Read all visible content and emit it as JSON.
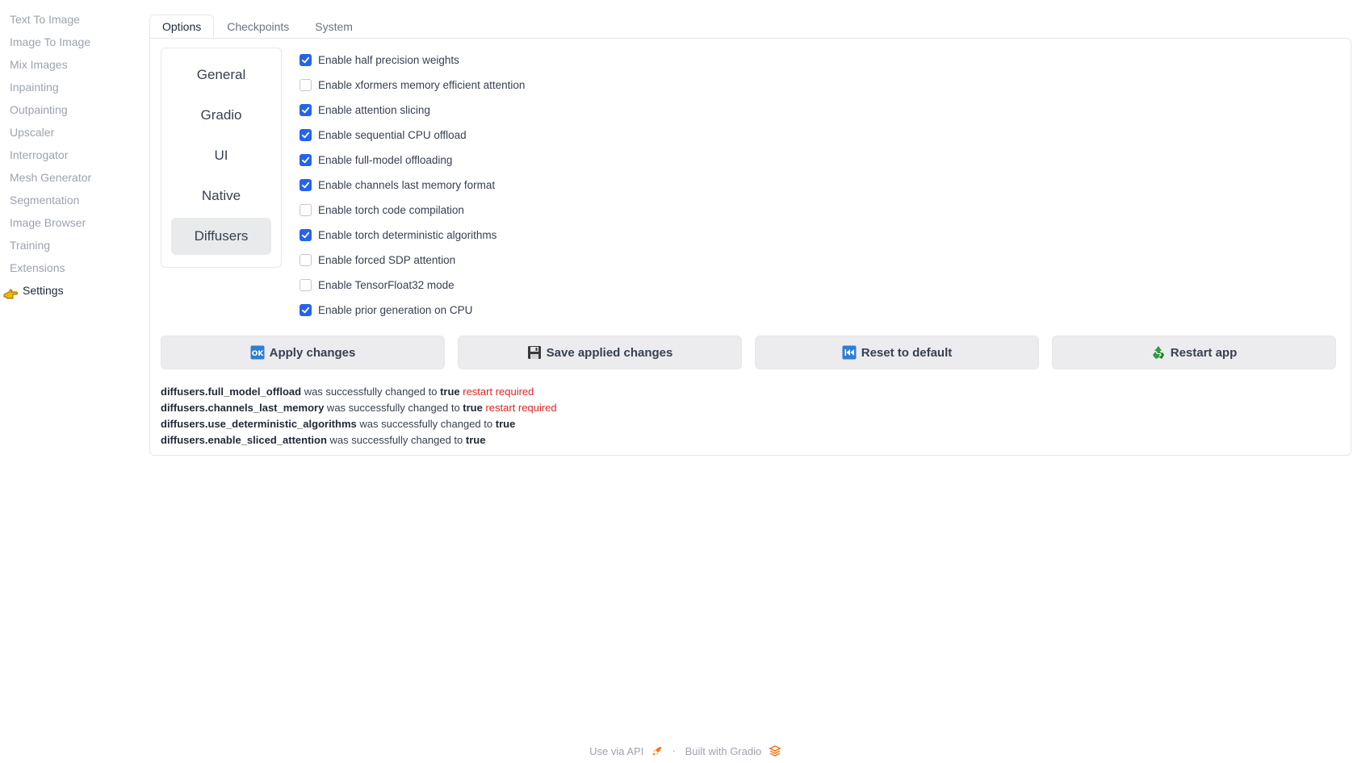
{
  "sidebar": {
    "items": [
      {
        "label": "Text To Image"
      },
      {
        "label": "Image To Image"
      },
      {
        "label": "Mix Images"
      },
      {
        "label": "Inpainting"
      },
      {
        "label": "Outpainting"
      },
      {
        "label": "Upscaler"
      },
      {
        "label": "Interrogator"
      },
      {
        "label": "Mesh Generator"
      },
      {
        "label": "Segmentation"
      },
      {
        "label": "Image Browser"
      },
      {
        "label": "Training"
      },
      {
        "label": "Extensions"
      }
    ],
    "active": {
      "label": "Settings",
      "icon": "pointing-hand-icon"
    }
  },
  "tabs": [
    {
      "label": "Options",
      "active": true
    },
    {
      "label": "Checkpoints",
      "active": false
    },
    {
      "label": "System",
      "active": false
    }
  ],
  "subnav": [
    {
      "label": "General"
    },
    {
      "label": "Gradio"
    },
    {
      "label": "UI"
    },
    {
      "label": "Native"
    },
    {
      "label": "Diffusers",
      "active": true
    }
  ],
  "options": [
    {
      "label": "Enable half precision weights",
      "checked": true
    },
    {
      "label": "Enable xformers memory efficient attention",
      "checked": false
    },
    {
      "label": "Enable attention slicing",
      "checked": true
    },
    {
      "label": "Enable sequential CPU offload",
      "checked": true
    },
    {
      "label": "Enable full-model offloading",
      "checked": true
    },
    {
      "label": "Enable channels last memory format",
      "checked": true
    },
    {
      "label": "Enable torch code compilation",
      "checked": false
    },
    {
      "label": "Enable torch deterministic algorithms",
      "checked": true
    },
    {
      "label": "Enable forced SDP attention",
      "checked": false
    },
    {
      "label": "Enable TensorFloat32 mode",
      "checked": false
    },
    {
      "label": "Enable prior generation on CPU",
      "checked": true
    }
  ],
  "buttons": {
    "apply": {
      "label": "Apply changes",
      "icon": "ok-icon"
    },
    "save": {
      "label": "Save applied changes",
      "icon": "floppy-disk-icon"
    },
    "reset": {
      "label": "Reset to default",
      "icon": "rewind-icon"
    },
    "restart": {
      "label": "Restart app",
      "icon": "recycle-icon"
    }
  },
  "log": [
    {
      "key": "diffusers.full_model_offload",
      "text": " was successfully changed to ",
      "value": "true",
      "warn": " restart required"
    },
    {
      "key": "diffusers.channels_last_memory",
      "text": " was successfully changed to ",
      "value": "true",
      "warn": " restart required"
    },
    {
      "key": "diffusers.use_deterministic_algorithms",
      "text": " was successfully changed to ",
      "value": "true",
      "warn": ""
    },
    {
      "key": "diffusers.enable_sliced_attention",
      "text": " was successfully changed to ",
      "value": "true",
      "warn": ""
    }
  ],
  "footer": {
    "api_label": "Use via API",
    "separator": "·",
    "built_label": "Built with Gradio"
  },
  "colors": {
    "accent": "#2563eb",
    "warning": "#dc2626",
    "muted": "#9ca3af"
  }
}
